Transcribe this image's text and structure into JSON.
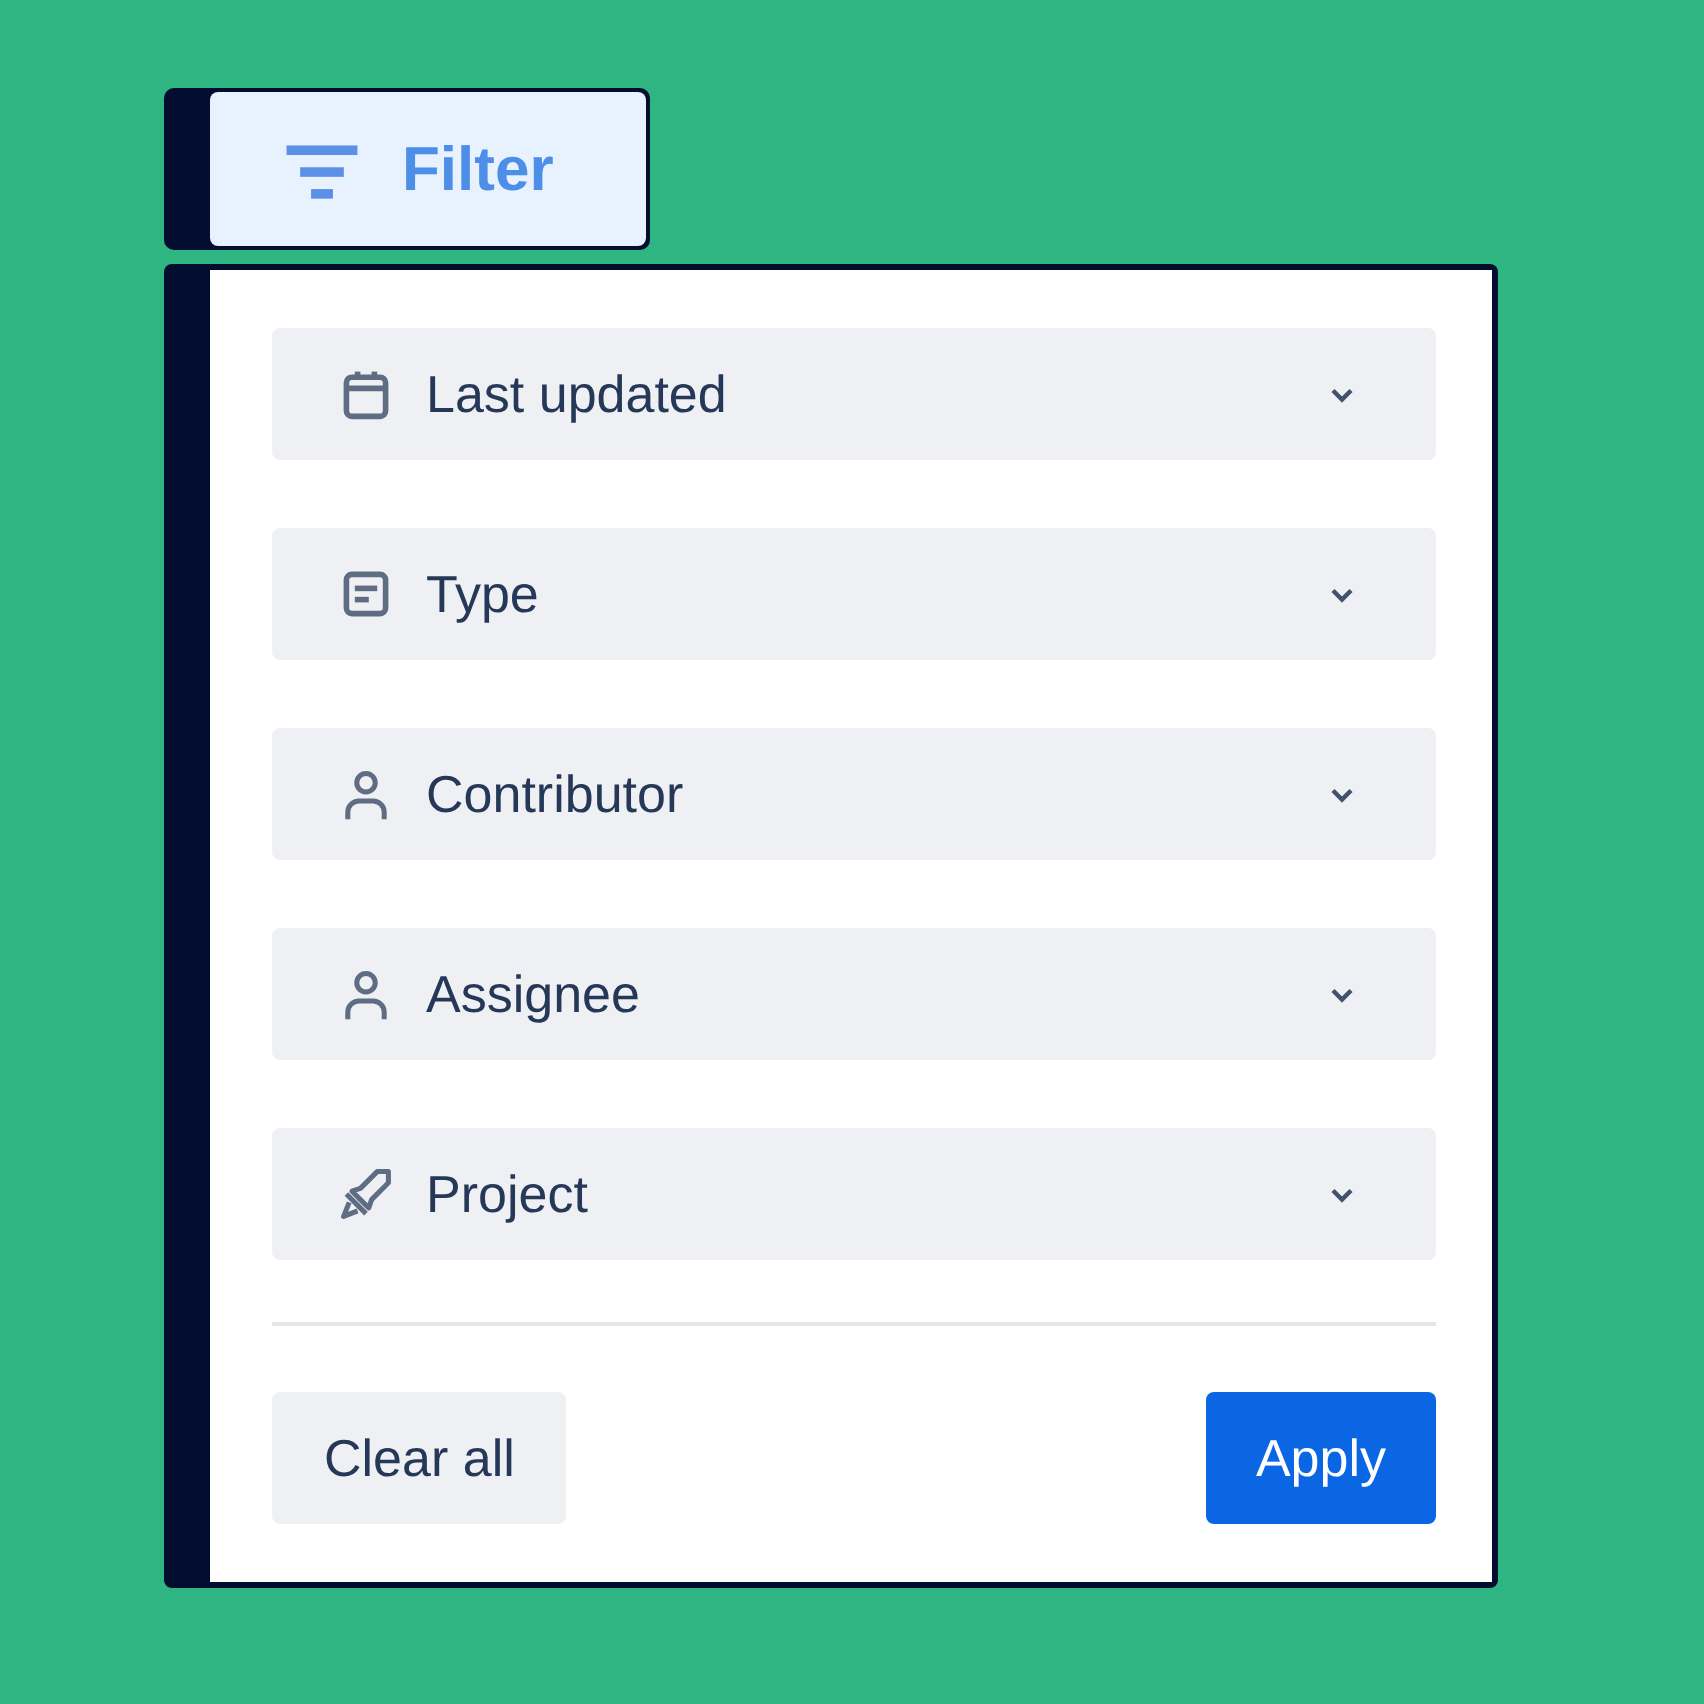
{
  "filter_button": {
    "label": "Filter"
  },
  "filters": [
    {
      "label": "Last updated"
    },
    {
      "label": "Type"
    },
    {
      "label": "Contributor"
    },
    {
      "label": "Assignee"
    },
    {
      "label": "Project"
    }
  ],
  "buttons": {
    "clear": "Clear all",
    "apply": "Apply"
  }
}
